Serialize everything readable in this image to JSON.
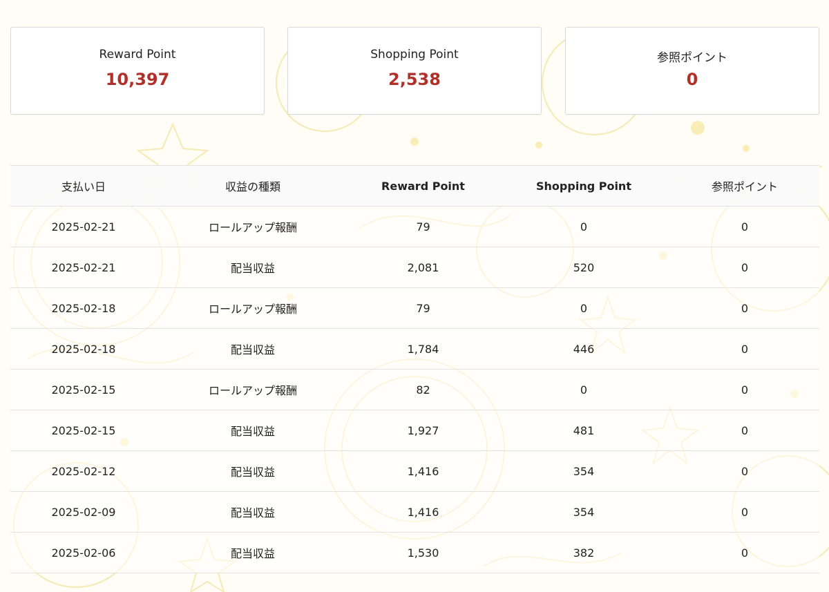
{
  "summary": {
    "cards": [
      {
        "label": "Reward Point",
        "value": "10,397"
      },
      {
        "label": "Shopping Point",
        "value": "2,538"
      },
      {
        "label": "参照ポイント",
        "value": "0"
      }
    ]
  },
  "history": {
    "headers": [
      "支払い日",
      "収益の種類",
      "Reward Point",
      "Shopping Point",
      "参照ポイント"
    ],
    "rows": [
      [
        "2025-02-21",
        "ロールアップ報酬",
        "79",
        "0",
        "0"
      ],
      [
        "2025-02-21",
        "配当収益",
        "2,081",
        "520",
        "0"
      ],
      [
        "2025-02-18",
        "ロールアップ報酬",
        "79",
        "0",
        "0"
      ],
      [
        "2025-02-18",
        "配当収益",
        "1,784",
        "446",
        "0"
      ],
      [
        "2025-02-15",
        "ロールアップ報酬",
        "82",
        "0",
        "0"
      ],
      [
        "2025-02-15",
        "配当収益",
        "1,927",
        "481",
        "0"
      ],
      [
        "2025-02-12",
        "配当収益",
        "1,416",
        "354",
        "0"
      ],
      [
        "2025-02-09",
        "配当収益",
        "1,416",
        "354",
        "0"
      ],
      [
        "2025-02-06",
        "配当収益",
        "1,530",
        "382",
        "0"
      ]
    ]
  },
  "colors": {
    "accent": "#b0312a",
    "background": "#fffdf6",
    "decoration": "#f3e3a0"
  }
}
